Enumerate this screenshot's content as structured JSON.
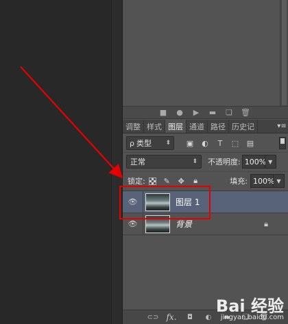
{
  "tabs": [
    {
      "label": "调整",
      "active": false
    },
    {
      "label": "样式",
      "active": false
    },
    {
      "label": "图层",
      "active": true
    },
    {
      "label": "通道",
      "active": false
    },
    {
      "label": "路径",
      "active": false
    },
    {
      "label": "历史记",
      "active": false
    }
  ],
  "filter": {
    "search_glyph": "ρ",
    "kind_label": "类型"
  },
  "blend": {
    "mode": "正常",
    "opacity_label": "不透明度:",
    "opacity_value": "100%"
  },
  "lock": {
    "label": "锁定:",
    "fill_label": "填充:",
    "fill_value": "100%"
  },
  "layers": [
    {
      "name": "图层 1",
      "selected": true,
      "visible": true,
      "locked": false
    },
    {
      "name": "背景",
      "selected": false,
      "visible": true,
      "locked": true
    }
  ],
  "bottom_toolbar": {
    "fx_label": "fx."
  },
  "watermark": {
    "brand": "Bai 经验",
    "url": "jingyan.baidu.com"
  },
  "colors": {
    "panel_bg": "#535353",
    "selected_layer": "#586278",
    "annotation_red": "#e60000"
  }
}
